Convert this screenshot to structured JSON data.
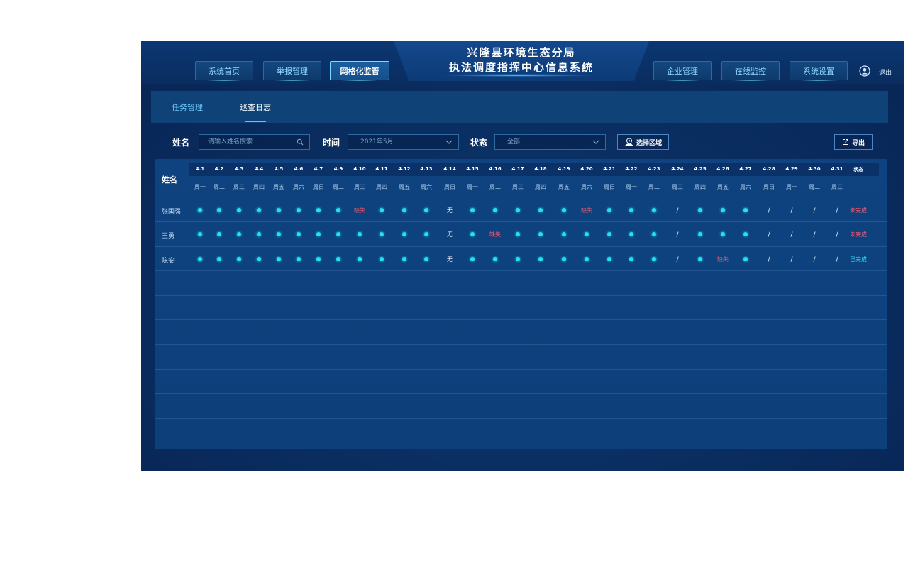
{
  "header": {
    "title_line1": "兴隆县环境生态分局",
    "title_line2": "执法调度指挥中心信息系统",
    "nav_left": [
      "系统首页",
      "举报管理",
      "网格化监管"
    ],
    "nav_right": [
      "企业管理",
      "在线监控",
      "系统设置"
    ],
    "active_nav": "网格化监管",
    "logout": "退出"
  },
  "tabs": {
    "task": "任务管理",
    "log": "巡查日志",
    "active": "巡查日志"
  },
  "filters": {
    "name_label": "姓名",
    "name_placeholder": "请输入姓名搜索",
    "time_label": "时间",
    "time_value": "2021年5月",
    "status_label": "状态",
    "status_value": "全部",
    "region_button": "选择区域",
    "export_button": "导出"
  },
  "table": {
    "name_header": "姓名",
    "status_header": "状态",
    "dates": [
      "4.1",
      "4.2",
      "4.3",
      "4.4",
      "4.5",
      "4.6",
      "4.7",
      "4.9",
      "4.10",
      "4.11",
      "4.12",
      "4.13",
      "4.14",
      "4.15",
      "4.16",
      "4.17",
      "4.18",
      "4.19",
      "4.20",
      "4.21",
      "4.22",
      "4.23",
      "4.24",
      "4.25",
      "4.26",
      "4.27",
      "4.28",
      "4.29",
      "4.30",
      "4.31"
    ],
    "weekdays": [
      "周一",
      "周二",
      "周三",
      "周四",
      "周五",
      "周六",
      "周日",
      "周二",
      "周三",
      "周四",
      "周五",
      "周六",
      "周日",
      "周一",
      "周二",
      "周三",
      "周四",
      "周五",
      "周六",
      "周日",
      "周一",
      "周二",
      "周三",
      "周四",
      "周五",
      "周六",
      "周日",
      "周一",
      "周二",
      "周三"
    ],
    "rows": [
      {
        "name": "张国强",
        "cells": [
          "dot",
          "dot",
          "dot",
          "dot",
          "dot",
          "dot",
          "dot",
          "dot",
          "缺失",
          "dot",
          "dot",
          "dot",
          "无",
          "dot",
          "dot",
          "dot",
          "dot",
          "dot",
          "缺失",
          "dot",
          "dot",
          "dot",
          "/",
          "dot",
          "dot",
          "dot",
          "/",
          "/",
          "/",
          "/"
        ],
        "status": "未完成"
      },
      {
        "name": "王勇",
        "cells": [
          "dot",
          "dot",
          "dot",
          "dot",
          "dot",
          "dot",
          "dot",
          "dot",
          "dot",
          "dot",
          "dot",
          "dot",
          "无",
          "dot",
          "缺失",
          "dot",
          "dot",
          "dot",
          "dot",
          "dot",
          "dot",
          "dot",
          "/",
          "dot",
          "dot",
          "dot",
          "/",
          "/",
          "/",
          "/"
        ],
        "status": "未完成"
      },
      {
        "name": "陈安",
        "cells": [
          "dot",
          "dot",
          "dot",
          "dot",
          "dot",
          "dot",
          "dot",
          "dot",
          "dot",
          "dot",
          "dot",
          "dot",
          "无",
          "dot",
          "dot",
          "dot",
          "dot",
          "dot",
          "dot",
          "dot",
          "dot",
          "dot",
          "/",
          "dot",
          "缺失",
          "dot",
          "/",
          "/",
          "/",
          "/"
        ],
        "status": "已完成"
      }
    ]
  },
  "colors": {
    "dot": "#22e3e6",
    "missing": "#ff5a6e",
    "done": "#2de3ea",
    "background": "#0a2f62"
  }
}
